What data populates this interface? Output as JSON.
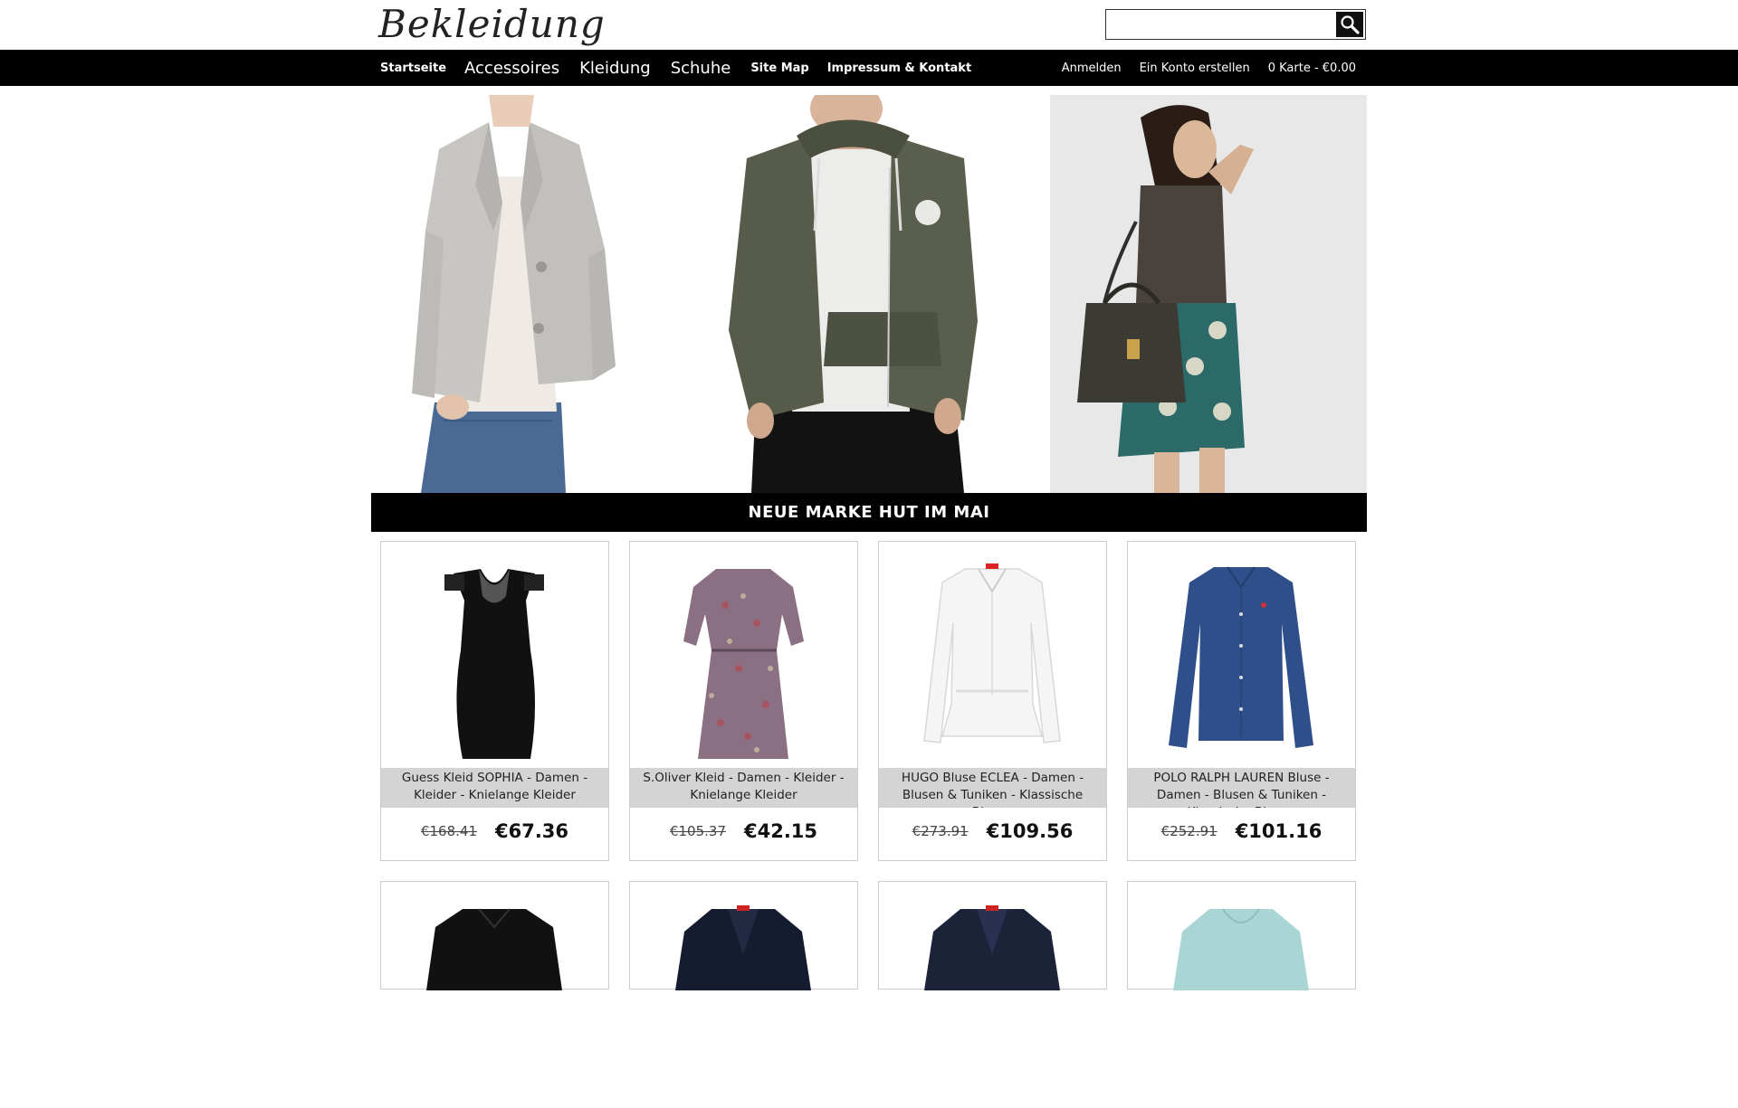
{
  "header": {
    "logo_text": "Bekleidung",
    "search_placeholder": "",
    "search_value": ""
  },
  "nav": {
    "left_items": [
      {
        "label": "Startseite",
        "style": "small"
      },
      {
        "label": "Accessoires",
        "style": "big"
      },
      {
        "label": "Kleidung",
        "style": "big"
      },
      {
        "label": "Schuhe",
        "style": "big"
      },
      {
        "label": "Site Map",
        "style": "small"
      },
      {
        "label": "Impressum & Kontakt",
        "style": "small"
      }
    ],
    "right_items": [
      {
        "label": "Anmelden"
      },
      {
        "label": "Ein Konto erstellen"
      },
      {
        "label": "0 Karte - €0.00"
      }
    ]
  },
  "hero": {
    "panels": [
      "blazer-woman",
      "hoodie-man",
      "handbag-woman"
    ],
    "banner_text": "NEUE MARKE HUT IM MAI"
  },
  "products": [
    {
      "title": "Guess Kleid SOPHIA - Damen - Kleider - Knielange Kleider",
      "old_price": "€168.41",
      "new_price": "€67.36",
      "image": "black-dress"
    },
    {
      "title": "S.Oliver Kleid - Damen - Kleider - Knielange Kleider",
      "old_price": "€105.37",
      "new_price": "€42.15",
      "image": "floral-dress"
    },
    {
      "title": "HUGO Bluse ECLEA - Damen - Blusen & Tuniken - Klassische Blusen",
      "old_price": "€273.91",
      "new_price": "€109.56",
      "image": "white-blouse"
    },
    {
      "title": "POLO RALPH LAUREN Bluse - Damen - Blusen & Tuniken - Klassische Blusen",
      "old_price": "€252.91",
      "new_price": "€101.16",
      "image": "blue-shirt"
    },
    {
      "title": "",
      "old_price": "",
      "new_price": "",
      "image": "black-shirt"
    },
    {
      "title": "",
      "old_price": "",
      "new_price": "",
      "image": "navy-blazer"
    },
    {
      "title": "",
      "old_price": "",
      "new_price": "",
      "image": "navy-blazer-2"
    },
    {
      "title": "",
      "old_price": "",
      "new_price": "",
      "image": "mint-jacket"
    }
  ],
  "colors": {
    "nav_bg": "#000000",
    "title_bg": "#d4d4d4",
    "text": "#222222"
  }
}
